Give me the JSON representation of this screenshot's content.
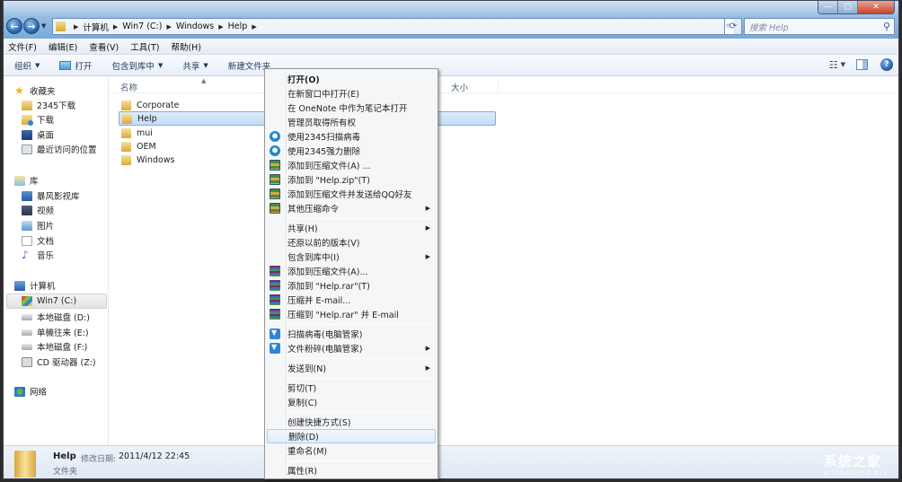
{
  "window": {
    "controls": {
      "minimize": "—",
      "maximize": "▢",
      "close": "✕"
    }
  },
  "address": {
    "breadcrumbs": [
      "计算机",
      "Win7 (C:)",
      "Windows",
      "Help"
    ],
    "search_placeholder": "搜索 Help"
  },
  "menubar": [
    "文件(F)",
    "编辑(E)",
    "查看(V)",
    "工具(T)",
    "帮助(H)"
  ],
  "toolbar": {
    "organize": "组织",
    "open": "打开",
    "include_library": "包含到库中",
    "share": "共享",
    "new_folder": "新建文件夹"
  },
  "sidebar": {
    "favorites": {
      "label": "收藏夹",
      "items": [
        "2345下载",
        "下载",
        "桌面",
        "最近访问的位置"
      ]
    },
    "libraries": {
      "label": "库",
      "items": [
        "暴风影视库",
        "视频",
        "图片",
        "文档",
        "音乐"
      ]
    },
    "computer": {
      "label": "计算机",
      "items": [
        "Win7 (C:)",
        "本地磁盘 (D:)",
        "单機往来 (E:)",
        "本地磁盘 (F:)",
        "CD 驱动器 (Z:)"
      ]
    },
    "network": {
      "label": "网络"
    }
  },
  "content": {
    "columns": {
      "name": "名称",
      "size": "大小"
    },
    "files": [
      {
        "name": "Corporate",
        "selected": false
      },
      {
        "name": "Help",
        "selected": true
      },
      {
        "name": "mui",
        "selected": false
      },
      {
        "name": "OEM",
        "selected": false
      },
      {
        "name": "Windows",
        "selected": false
      }
    ]
  },
  "context_menu": {
    "items": [
      {
        "label": "打开(O)",
        "bold": true
      },
      {
        "label": "在新窗口中打开(E)"
      },
      {
        "label": "在 OneNote 中作为笔记本打开"
      },
      {
        "label": "管理员取得所有权"
      },
      {
        "label": "使用2345扫描病毒",
        "icon": "shield-2345-icon"
      },
      {
        "label": "使用2345强力删除",
        "icon": "shield-2345-icon"
      },
      {
        "label": "添加到压缩文件(A) ...",
        "icon": "zip-archive-icon"
      },
      {
        "label": "添加到 \"Help.zip\"(T)",
        "icon": "zip-archive-icon"
      },
      {
        "label": "添加到压缩文件并发送给QQ好友",
        "icon": "zip-archive-icon"
      },
      {
        "label": "其他压缩命令",
        "icon": "zip-archive-icon",
        "submenu": true
      },
      {
        "label": "共享(H)",
        "submenu": true
      },
      {
        "label": "还原以前的版本(V)"
      },
      {
        "label": "包含到库中(I)",
        "submenu": true
      },
      {
        "label": "添加到压缩文件(A)...",
        "icon": "winrar-icon"
      },
      {
        "label": "添加到 \"Help.rar\"(T)",
        "icon": "winrar-icon"
      },
      {
        "label": "压缩并 E-mail...",
        "icon": "winrar-icon"
      },
      {
        "label": "压缩到 \"Help.rar\" 并 E-mail",
        "icon": "winrar-icon"
      },
      {
        "label": "扫描病毒(电脑管家)",
        "icon": "tencent-guard-icon"
      },
      {
        "label": "文件粉碎(电脑管家)",
        "icon": "tencent-guard-icon",
        "submenu": true
      },
      {
        "label": "发送到(N)",
        "submenu": true
      },
      {
        "label": "剪切(T)"
      },
      {
        "label": "复制(C)"
      },
      {
        "label": "创建快捷方式(S)"
      },
      {
        "label": "删除(D)",
        "hovered": true
      },
      {
        "label": "重命名(M)"
      },
      {
        "label": "属性(R)"
      }
    ]
  },
  "status": {
    "name": "Help",
    "modified_label": "修改日期:",
    "modified_value": "2011/4/12 22:45",
    "type": "文件夹"
  },
  "watermark": {
    "text": "系统之家",
    "sub": "XITONGZHIJIA.NET"
  }
}
